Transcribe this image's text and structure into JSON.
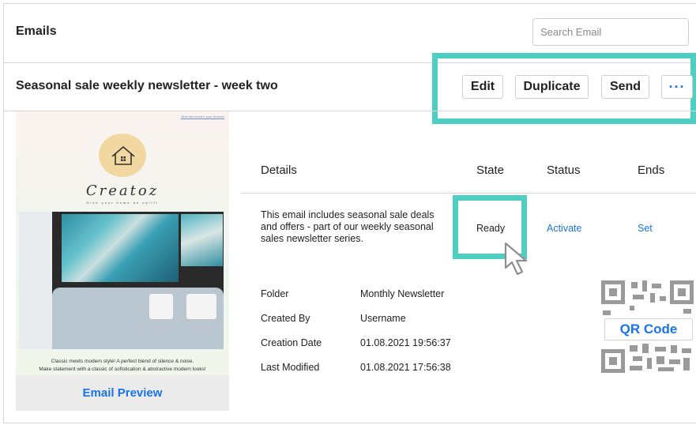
{
  "header": {
    "title": "Emails",
    "search_placeholder": "Search Email"
  },
  "email": {
    "name": "Seasonal sale weekly newsletter - week two"
  },
  "toolbar": {
    "edit_label": "Edit",
    "duplicate_label": "Duplicate",
    "send_label": "Send",
    "more_label": "···"
  },
  "preview": {
    "view_in_browser": "View this email in your browser",
    "brand": "Creatoz",
    "tagline": "Give your home an uplift",
    "copy_line1": "Classic meets modern style! A perfect blend of silence & noise.",
    "copy_line2": "Make statement with a classic of sofistication & abstractive modern looks!",
    "link_label": "Email Preview"
  },
  "details": {
    "columns": [
      "Details",
      "State",
      "Status",
      "Ends"
    ],
    "description": "This email includes seasonal sale deals and offers - part of our weekly seasonal sales newsletter series.",
    "state": "Ready",
    "status_link": "Activate",
    "ends_link": "Set"
  },
  "meta": [
    {
      "label": "Folder",
      "value": "Monthly Newsletter"
    },
    {
      "label": "Created By",
      "value": "Username"
    },
    {
      "label": "Creation Date",
      "value": "01.08.2021 19:56:37"
    },
    {
      "label": "Last Modified",
      "value": "01.08.2021 17:56:38"
    }
  ],
  "qr": {
    "label": "QR Code"
  },
  "colors": {
    "accent": "#1a73e8",
    "highlight": "#4ecfc1"
  },
  "icons": [
    "house-logo-icon",
    "qr-code-icon",
    "mouse-pointer-icon"
  ]
}
